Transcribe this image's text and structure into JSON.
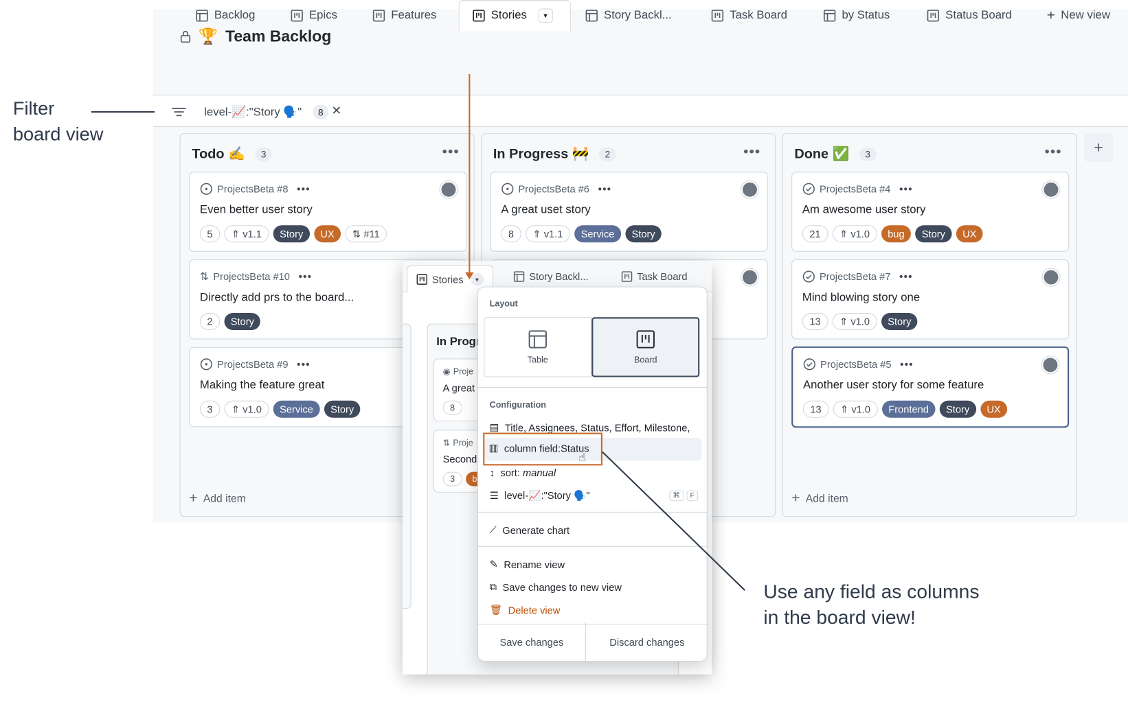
{
  "header": {
    "title": "Team Backlog",
    "title_emoji": "🏆"
  },
  "tabs": [
    {
      "label": "Backlog",
      "icon": "table-icon"
    },
    {
      "label": "Epics",
      "icon": "board-icon"
    },
    {
      "label": "Features",
      "icon": "board-icon"
    },
    {
      "label": "Stories",
      "icon": "board-icon"
    },
    {
      "label": "Story Backl...",
      "icon": "table-icon"
    },
    {
      "label": "Task Board",
      "icon": "board-icon"
    },
    {
      "label": "by Status",
      "icon": "table-icon"
    },
    {
      "label": "Status Board",
      "icon": "board-icon"
    },
    {
      "label": "New view",
      "icon": "plus-icon"
    }
  ],
  "filter": {
    "text": "level-📈:\"Story 🗣️\"",
    "count": "8",
    "clear": "✕"
  },
  "callouts": {
    "left_line1": "Filter",
    "left_line2": "board view",
    "right_line1": "Use any field as columns",
    "right_line2": "in the board view!"
  },
  "columns": [
    {
      "title": "Todo ✍️",
      "count": "3",
      "add_label": "Add item",
      "cards": [
        {
          "ref": "ProjectsBeta #8",
          "title": "Even better user story",
          "labels": [
            {
              "t": "5",
              "k": "num"
            },
            {
              "t": "v1.1",
              "k": "num"
            },
            {
              "t": "Story",
              "k": "dark"
            },
            {
              "t": "UX",
              "k": "orange"
            },
            {
              "t": "#11",
              "k": "num"
            }
          ]
        },
        {
          "ref": "ProjectsBeta #10",
          "title": "Directly add prs to the board...",
          "labels": [
            {
              "t": "2",
              "k": "num"
            },
            {
              "t": "Story",
              "k": "dark"
            }
          ]
        },
        {
          "ref": "ProjectsBeta #9",
          "title": "Making the feature great",
          "labels": [
            {
              "t": "3",
              "k": "num"
            },
            {
              "t": "v1.0",
              "k": "num"
            },
            {
              "t": "Service",
              "k": "service"
            },
            {
              "t": "Story",
              "k": "dark"
            }
          ]
        }
      ]
    },
    {
      "title": "In Progress 🚧",
      "count": "2",
      "cards": [
        {
          "ref": "ProjectsBeta #6",
          "title": "A great uset story",
          "labels": [
            {
              "t": "8",
              "k": "num"
            },
            {
              "t": "v1.1",
              "k": "num"
            },
            {
              "t": "Service",
              "k": "service"
            },
            {
              "t": "Story",
              "k": "dark"
            }
          ]
        }
      ]
    },
    {
      "title": "Done ✅",
      "count": "3",
      "add_label": "Add item",
      "cards": [
        {
          "ref": "ProjectsBeta #4",
          "title": "Am awesome user story",
          "labels": [
            {
              "t": "21",
              "k": "num"
            },
            {
              "t": "v1.0",
              "k": "num"
            },
            {
              "t": "bug",
              "k": "orange"
            },
            {
              "t": "Story",
              "k": "dark"
            },
            {
              "t": "UX",
              "k": "orange"
            }
          ]
        },
        {
          "ref": "ProjectsBeta #7",
          "title": "Mind blowing story one",
          "labels": [
            {
              "t": "13",
              "k": "num"
            },
            {
              "t": "v1.0",
              "k": "num"
            },
            {
              "t": "Story",
              "k": "dark"
            }
          ]
        },
        {
          "ref": "ProjectsBeta #5",
          "title": "Another user story for some feature",
          "labels": [
            {
              "t": "13",
              "k": "num"
            },
            {
              "t": "v1.0",
              "k": "num"
            },
            {
              "t": "Frontend",
              "k": "service"
            },
            {
              "t": "Story",
              "k": "dark"
            },
            {
              "t": "UX",
              "k": "orange"
            }
          ]
        }
      ]
    }
  ],
  "overlay": {
    "tabs": [
      "Stories",
      "Story Backl...",
      "Task Board"
    ],
    "col_title": "In Progr",
    "card1_ref": "Proje",
    "card1_title": "A great",
    "card1_num": "8",
    "card2_ref": "Proje",
    "card2_title": "Second",
    "card2_num": "3",
    "card2_label": "bu"
  },
  "menu": {
    "layout_heading": "Layout",
    "layout_table": "Table",
    "layout_board": "Board",
    "config_heading": "Configuration",
    "fields": "Title, Assignees, Status, Effort, Milestone,",
    "column_field_prefix": "column field:",
    "column_field_value": "Status",
    "sort_prefix": "sort:",
    "sort_value": "manual",
    "filter": "level-📈:\"Story 🗣️\"",
    "kbd1": "⌘",
    "kbd2": "F",
    "generate_chart": "Generate chart",
    "rename": "Rename view",
    "save_new": "Save changes to new view",
    "delete": "Delete view",
    "save": "Save changes",
    "discard": "Discard changes"
  },
  "colors": {
    "accent_orange": "#c66a2a",
    "label_dark": "#3f4a5c",
    "label_blue": "#5b6f98"
  }
}
